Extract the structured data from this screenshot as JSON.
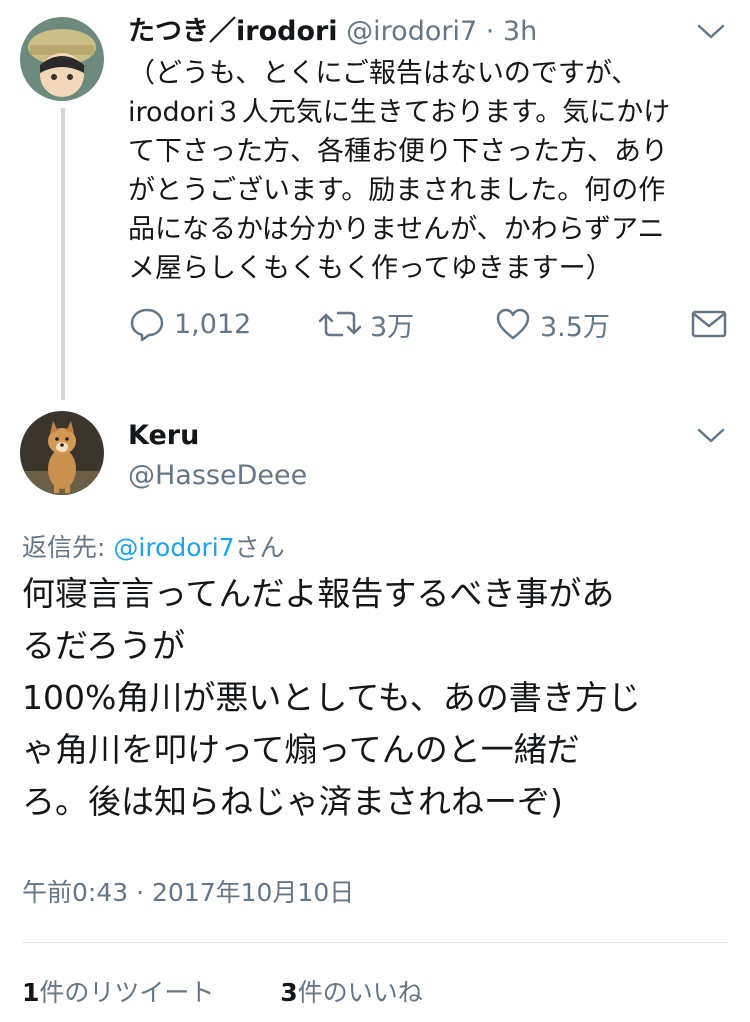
{
  "tweet1": {
    "display_name": "たつき／irodori",
    "handle": "@irodori7",
    "separator": "·",
    "time": "3h",
    "body_lines": [
      "（どうも、とくにご報告はないのですが、",
      "irodori３人元気に生きております。気にかけ",
      "て下さった方、各種お便り下さった方、あり",
      "がとうございます。励まされました。何の作",
      "品になるかは分かりませんが、かわらずアニ",
      "メ屋らしくもくもく作ってゆきますー）"
    ],
    "replies": "1,012",
    "retweets": "3万",
    "likes": "3.5万"
  },
  "tweet2": {
    "display_name": "Keru",
    "handle": "@HasseDeee",
    "reply_prefix": "返信先: ",
    "reply_mention": "@irodori7",
    "reply_suffix": "さん",
    "body_lines": [
      "何寝言言ってんだよ報告するべき事があ",
      "るだろうが",
      "100%角川が悪いとしても、あの書き方じ",
      "ゃ角川を叩けって煽ってんのと一緒だ",
      "ろ。後は知らねじゃ済まされねーぞ)"
    ],
    "timestamp": "午前0:43 · 2017年10月10日",
    "retweet_count": "1",
    "retweet_label": "件のリツイート",
    "like_count": "3",
    "like_label": "件のいいね"
  },
  "colors": {
    "text": "#14171a",
    "secondary": "#657786",
    "link": "#1da1f2",
    "thread_line": "#ccd6dd",
    "divider": "#e1e8ed"
  }
}
